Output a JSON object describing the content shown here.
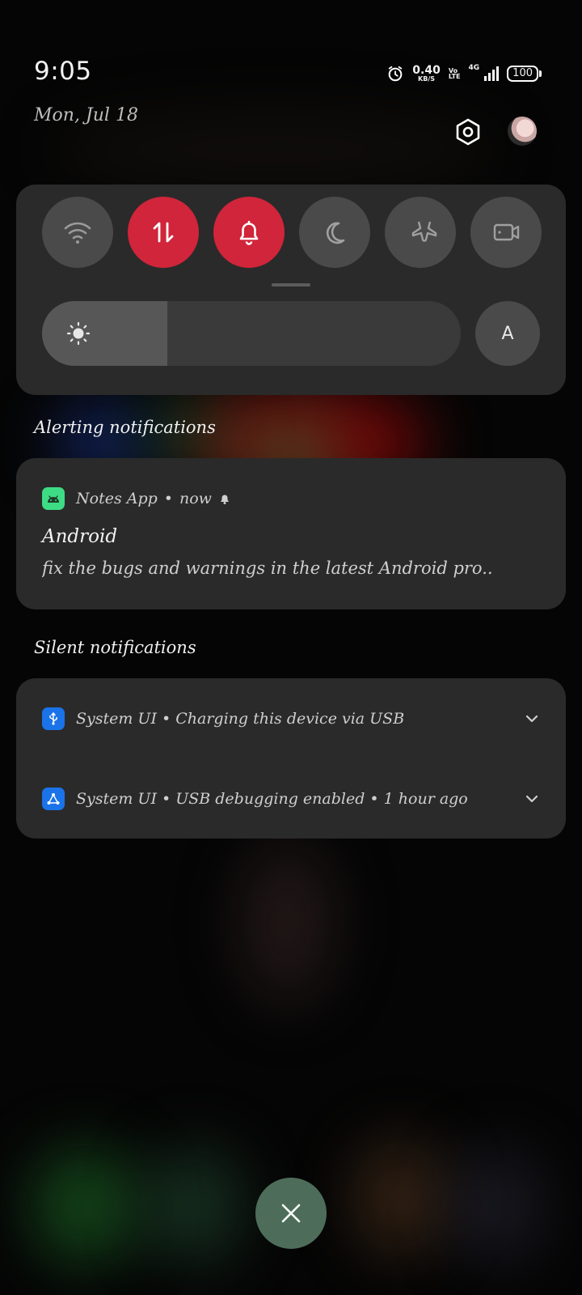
{
  "status_bar": {
    "time": "9:05",
    "net_speed_value": "0.40",
    "net_speed_unit": "KB/S",
    "volte_top": "Vo",
    "volte_bottom": "LTE",
    "network_type": "4G",
    "battery_level": "100",
    "icons": [
      "alarm-icon",
      "signal-icon",
      "battery-icon"
    ]
  },
  "header": {
    "date": "Mon, Jul 18"
  },
  "quick_settings": {
    "tiles": [
      {
        "name": "wifi",
        "active": false
      },
      {
        "name": "mobile-data",
        "active": true
      },
      {
        "name": "sound",
        "active": true
      },
      {
        "name": "dark-mode",
        "active": false
      },
      {
        "name": "airplane-mode",
        "active": false
      },
      {
        "name": "screen-record",
        "active": false
      }
    ],
    "brightness_level": 0.3,
    "auto_brightness_label": "A"
  },
  "alerting": {
    "section_label": "Alerting notifications",
    "notification": {
      "app_name": "Notes App",
      "time": "now",
      "title": "Android",
      "body": "fix the bugs and warnings in the latest Android pro.."
    }
  },
  "silent": {
    "section_label": "Silent notifications",
    "items": [
      {
        "text": "System UI • Charging this device via USB"
      },
      {
        "text": "System UI • USB debugging enabled • 1 hour ago"
      }
    ]
  },
  "colors": {
    "accent_active": "#d0253a",
    "panel_bg": "#2a2a2a",
    "dismiss_bg": "#4d6d5a"
  }
}
